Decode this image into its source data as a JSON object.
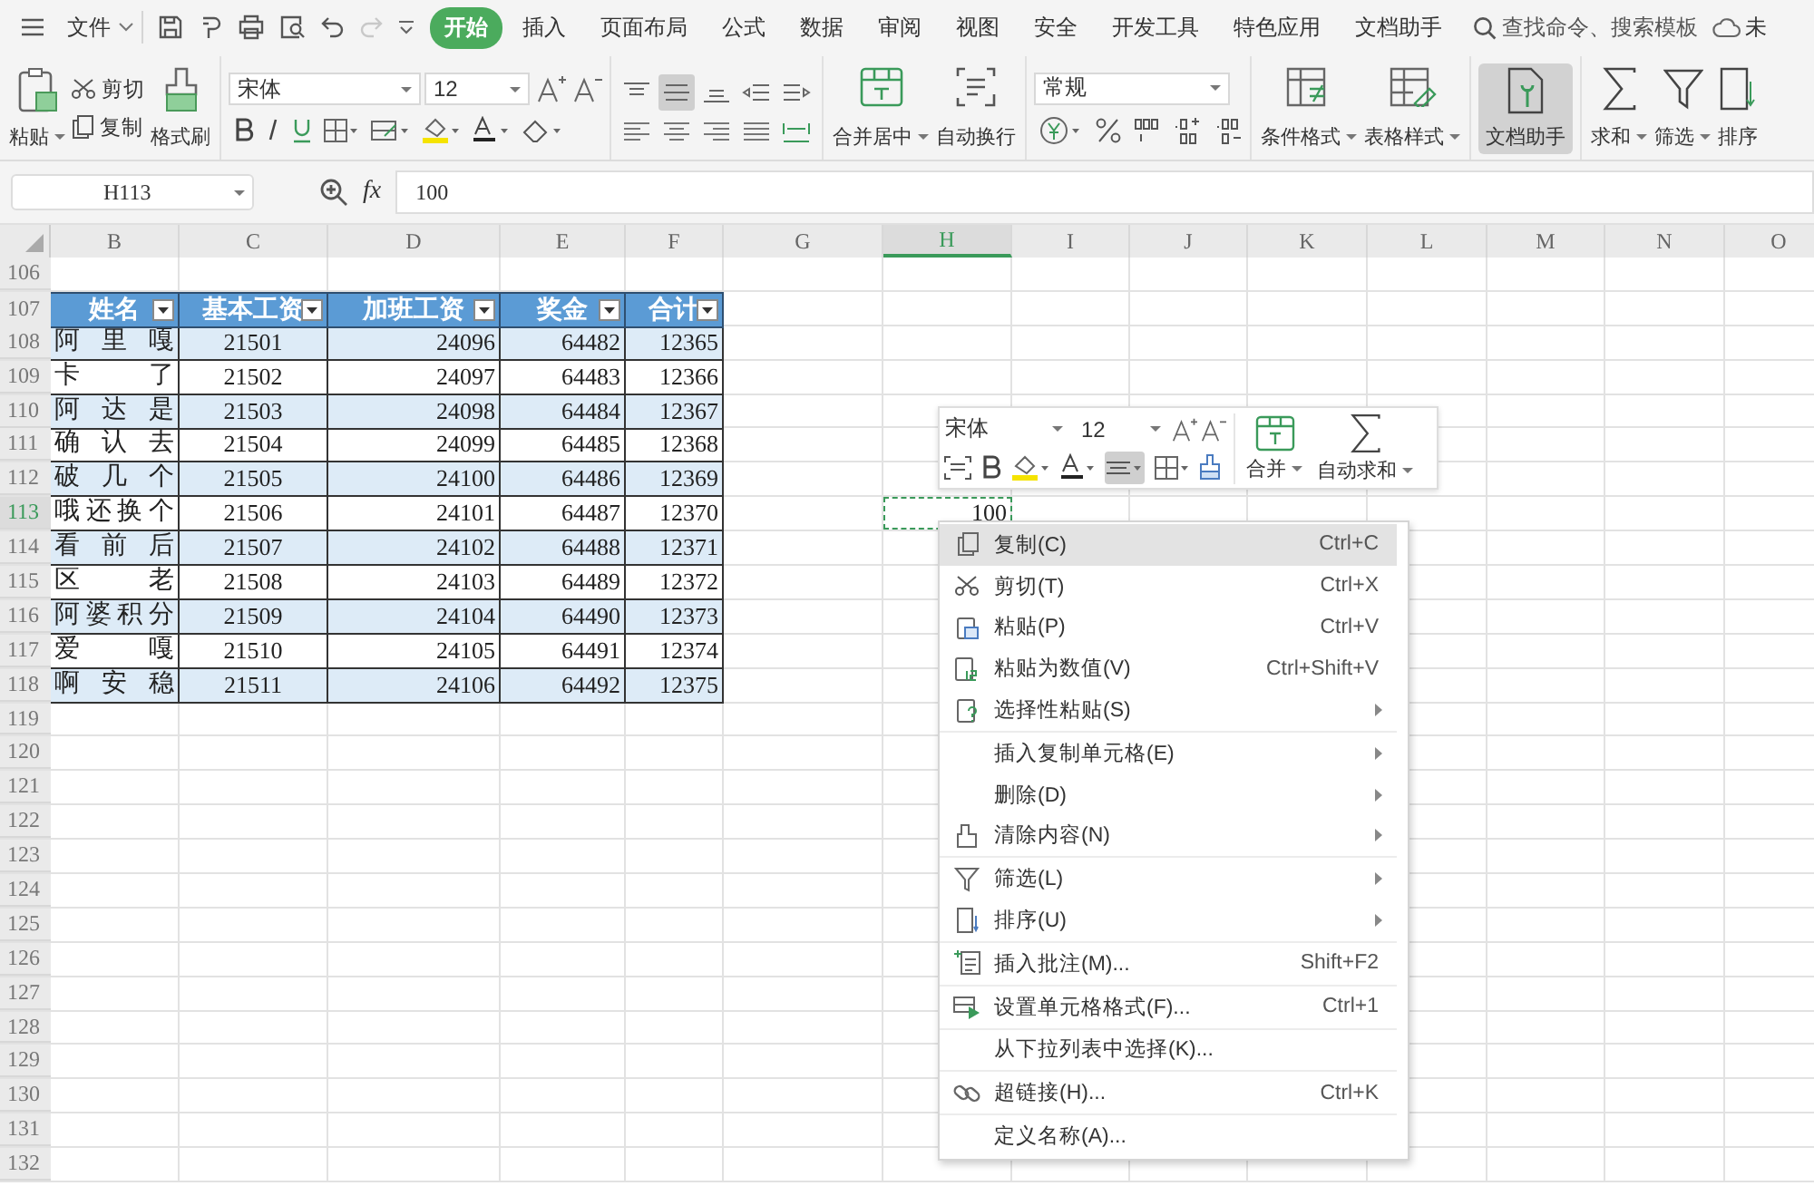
{
  "menu_bar": {
    "file_menu": "文件",
    "redo_enabled": false,
    "tabs": [
      {
        "label": "开始",
        "selected": true
      },
      {
        "label": "插入",
        "selected": false
      },
      {
        "label": "页面布局",
        "selected": false
      },
      {
        "label": "公式",
        "selected": false
      },
      {
        "label": "数据",
        "selected": false
      },
      {
        "label": "审阅",
        "selected": false
      },
      {
        "label": "视图",
        "selected": false
      },
      {
        "label": "安全",
        "selected": false
      },
      {
        "label": "开发工具",
        "selected": false
      },
      {
        "label": "特色应用",
        "selected": false
      },
      {
        "label": "文档助手",
        "selected": false
      }
    ],
    "search": "查找命令、搜索模板",
    "cloud": "未"
  },
  "ribbon": {
    "paste": "粘贴",
    "cut": "剪切",
    "copy": "复制",
    "format_painter": "格式刷",
    "font_name": "宋体",
    "font_size": "12",
    "align_buttons": [
      {
        "selected": false
      },
      {
        "selected": true
      },
      {
        "selected": false
      },
      {
        "selected": false
      },
      {
        "selected": false
      }
    ],
    "merge_center": "合并居中",
    "wrap_text": "自动换行",
    "number_format": "常规",
    "conditional_format": "条件格式",
    "table_style": "表格样式",
    "doc_assistant": {
      "label": "文档助手",
      "selected": true
    },
    "sum": "求和",
    "filter": "筛选",
    "sort": "排序"
  },
  "formula_bar": {
    "cell_ref": "H113",
    "fx": "fx",
    "value": "100"
  },
  "sheet": {
    "columns": [
      {
        "label": "B",
        "selected": false
      },
      {
        "label": "C",
        "selected": false
      },
      {
        "label": "D",
        "selected": false
      },
      {
        "label": "E",
        "selected": false
      },
      {
        "label": "F",
        "selected": false
      },
      {
        "label": "G",
        "selected": false
      },
      {
        "label": "H",
        "selected": true
      },
      {
        "label": "I",
        "selected": false
      },
      {
        "label": "J",
        "selected": false
      },
      {
        "label": "K",
        "selected": false
      },
      {
        "label": "L",
        "selected": false
      },
      {
        "label": "M",
        "selected": false
      },
      {
        "label": "N",
        "selected": false
      },
      {
        "label": "O",
        "selected": false
      }
    ],
    "rows": [
      {
        "label": "106",
        "selected": false
      },
      {
        "label": "107",
        "selected": false
      },
      {
        "label": "108",
        "selected": false
      },
      {
        "label": "109",
        "selected": false
      },
      {
        "label": "110",
        "selected": false
      },
      {
        "label": "111",
        "selected": false
      },
      {
        "label": "112",
        "selected": false
      },
      {
        "label": "113",
        "selected": true
      },
      {
        "label": "114",
        "selected": false
      },
      {
        "label": "115",
        "selected": false
      },
      {
        "label": "116",
        "selected": false
      },
      {
        "label": "117",
        "selected": false
      },
      {
        "label": "118",
        "selected": false
      },
      {
        "label": "119",
        "selected": false
      },
      {
        "label": "120",
        "selected": false
      },
      {
        "label": "121",
        "selected": false
      },
      {
        "label": "122",
        "selected": false
      },
      {
        "label": "123",
        "selected": false
      },
      {
        "label": "124",
        "selected": false
      },
      {
        "label": "125",
        "selected": false
      },
      {
        "label": "126",
        "selected": false
      },
      {
        "label": "127",
        "selected": false
      },
      {
        "label": "128",
        "selected": false
      },
      {
        "label": "129",
        "selected": false
      },
      {
        "label": "130",
        "selected": false
      },
      {
        "label": "131",
        "selected": false
      },
      {
        "label": "132",
        "selected": false
      }
    ],
    "active_cell_value": "100",
    "table": {
      "columns": [
        "姓名",
        "基本工资",
        "加班工资",
        "奖金",
        "合计"
      ],
      "rows": [
        [
          "阿里嘎",
          "21501",
          "24096",
          "64482",
          "12365"
        ],
        [
          "卡了",
          "21502",
          "24097",
          "64483",
          "12366"
        ],
        [
          "阿达是",
          "21503",
          "24098",
          "64484",
          "12367"
        ],
        [
          "确认去",
          "21504",
          "24099",
          "64485",
          "12368"
        ],
        [
          "破几个",
          "21505",
          "24100",
          "64486",
          "12369"
        ],
        [
          "哦还换个",
          "21506",
          "24101",
          "64487",
          "12370"
        ],
        [
          "看前后",
          "21507",
          "24102",
          "64488",
          "12371"
        ],
        [
          "区老",
          "21508",
          "24103",
          "64489",
          "12372"
        ],
        [
          "阿婆积分",
          "21509",
          "24104",
          "64490",
          "12373"
        ],
        [
          "爱嘎",
          "21510",
          "24105",
          "64491",
          "12374"
        ],
        [
          "啊安稳",
          "21511",
          "24106",
          "64492",
          "12375"
        ]
      ]
    }
  },
  "mini_toolbar": {
    "font_name": "宋体",
    "font_size": "12",
    "align_center_selected": true,
    "merge": "合并",
    "autosum": "自动求和"
  },
  "context_menu": {
    "groups": [
      [
        {
          "label": "复制(C)",
          "shortcut": "Ctrl+C",
          "submenu": false,
          "highlighted": true
        },
        {
          "label": "剪切(T)",
          "shortcut": "Ctrl+X",
          "submenu": false,
          "highlighted": false
        },
        {
          "label": "粘贴(P)",
          "shortcut": "Ctrl+V",
          "submenu": false,
          "highlighted": false
        },
        {
          "label": "粘贴为数值(V)",
          "shortcut": "Ctrl+Shift+V",
          "submenu": false,
          "highlighted": false
        },
        {
          "label": "选择性粘贴(S)",
          "submenu": true,
          "highlighted": false
        }
      ],
      [
        {
          "label": "插入复制单元格(E)",
          "submenu": true,
          "highlighted": false
        },
        {
          "label": "删除(D)",
          "submenu": true,
          "highlighted": false
        },
        {
          "label": "清除内容(N)",
          "submenu": true,
          "highlighted": false
        }
      ],
      [
        {
          "label": "筛选(L)",
          "submenu": true,
          "highlighted": false
        },
        {
          "label": "排序(U)",
          "submenu": true,
          "highlighted": false
        }
      ],
      [
        {
          "label": "插入批注(M)...",
          "shortcut": "Shift+F2",
          "submenu": false,
          "highlighted": false
        }
      ],
      [
        {
          "label": "设置单元格格式(F)...",
          "shortcut": "Ctrl+1",
          "submenu": false,
          "highlighted": false
        }
      ],
      [
        {
          "label": "从下拉列表中选择(K)...",
          "submenu": false,
          "highlighted": false
        }
      ],
      [
        {
          "label": "超链接(H)...",
          "shortcut": "Ctrl+K",
          "submenu": false,
          "highlighted": false
        }
      ],
      [
        {
          "label": "定义名称(A)...",
          "submenu": false,
          "highlighted": false
        }
      ]
    ]
  }
}
